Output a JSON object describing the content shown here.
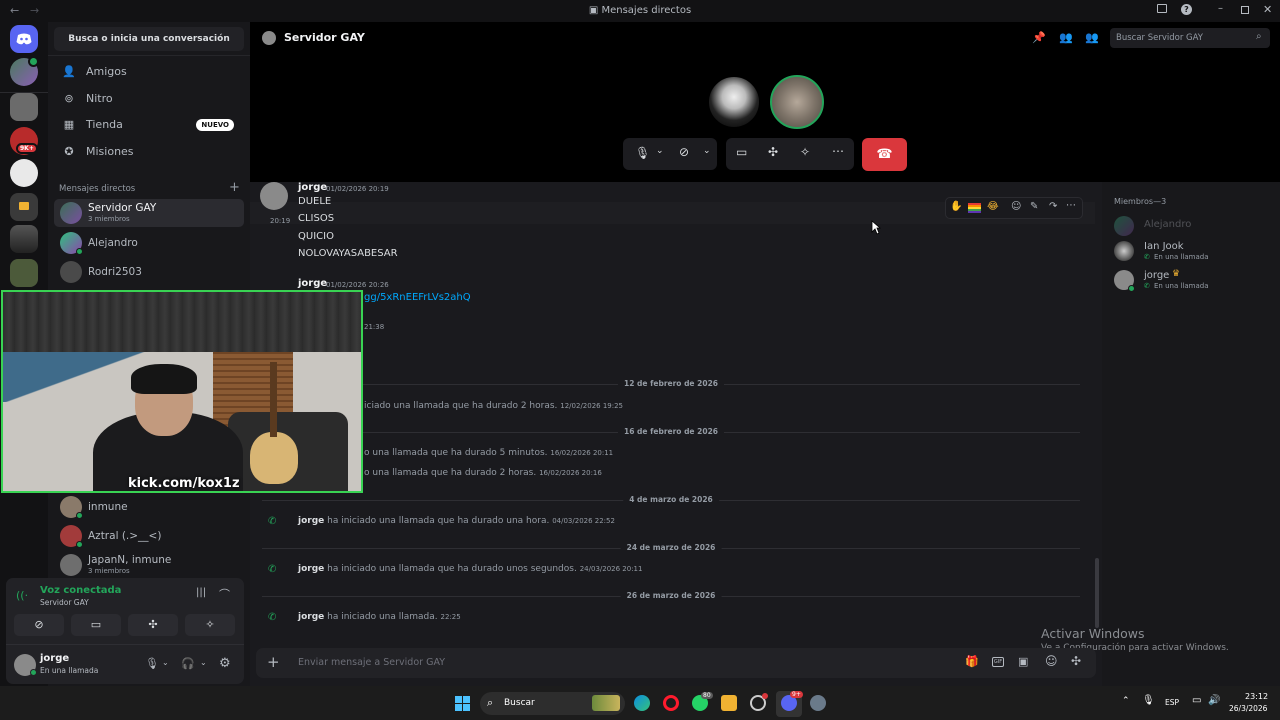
{
  "window": {
    "title": "Mensajes directos"
  },
  "dm_sidebar": {
    "search_label": "Busca o inicia una conversación",
    "nav": [
      {
        "label": "Amigos",
        "icon": "friends-icon"
      },
      {
        "label": "Nitro",
        "icon": "nitro-icon"
      },
      {
        "label": "Tienda",
        "icon": "shop-icon",
        "badge": "NUEVO"
      },
      {
        "label": "Misiones",
        "icon": "quests-icon"
      }
    ],
    "dm_header": "Mensajes directos",
    "dms": [
      {
        "name": "Servidor GAY",
        "sub": "3 miembros"
      },
      {
        "name": "Alejandro",
        "sub": ""
      },
      {
        "name": "Rodri2503",
        "sub": ""
      },
      {
        "name": "inmune",
        "sub": ""
      },
      {
        "name": "Aztral (.>__<)",
        "sub": ""
      },
      {
        "name": "JapanN, inmune",
        "sub": "3 miembros"
      }
    ]
  },
  "voice_panel": {
    "status": "Voz conectada",
    "server": "Servidor GAY",
    "user_name": "jorge",
    "user_status": "En una llamada"
  },
  "header": {
    "channel_name": "Servidor GAY",
    "search_placeholder": "Buscar Servidor GAY"
  },
  "webcam": {
    "overlay_text": "kick.com/kox1z"
  },
  "messages": {
    "m1": {
      "author": "jorge",
      "time": "01/02/2026 20:19",
      "lines": [
        "DUELE",
        "CLISOS",
        "QUICIO",
        "NOLOVAYASABESAR"
      ],
      "hover_time": "20:19"
    },
    "m2": {
      "author": "jorge",
      "time": "01/02/2026 20:26",
      "link": "gg/5xRnEEFrLVs2ahQ",
      "extra_time": "21:38"
    },
    "sys1": {
      "date": "12 de febrero de 2026",
      "text": "iciado una llamada que ha durado 2 horas.",
      "time": "12/02/2026 19:25"
    },
    "sys2": {
      "date": "16 de febrero de 2026",
      "text": "o una llamada que ha durado 5 minutos.",
      "time": "16/02/2026 20:11"
    },
    "sys3": {
      "text": "o una llamada que ha durado 2 horas.",
      "time": "16/02/2026 20:16"
    },
    "sys4": {
      "date": "4 de marzo de 2026",
      "author": "jorge",
      "text": "ha iniciado una llamada que ha durado una hora.",
      "time": "04/03/2026 22:52"
    },
    "sys5": {
      "date": "24 de marzo de 2026",
      "author": "jorge",
      "text": "ha iniciado una llamada que ha durado unos segundos.",
      "time": "24/03/2026 20:11"
    },
    "sys6": {
      "date": "26 de marzo de 2026",
      "author": "jorge",
      "text": "ha iniciado una llamada.",
      "time": "22:25"
    }
  },
  "composer": {
    "placeholder": "Enviar mensaje a Servidor GAY"
  },
  "members": {
    "header": "Miembros—3",
    "list": [
      {
        "name": "Alejandro",
        "status": ""
      },
      {
        "name": "Ian Jook",
        "status": "En una llamada"
      },
      {
        "name": "jorge",
        "status": "En una llamada"
      }
    ]
  },
  "watermark": {
    "line1": "Activar Windows",
    "line2": "Ve a Configuración para activar Windows."
  },
  "taskbar": {
    "search_label": "Buscar",
    "lang": "ESP",
    "time": "23:12",
    "date": "26/3/2026",
    "badge1": "80",
    "badge2": "9+"
  },
  "server_badges": {
    "s3": "9K+"
  },
  "colors": {
    "accent": "#5865f2",
    "green": "#23a55a",
    "danger": "#da373c",
    "link": "#00a8fc"
  }
}
